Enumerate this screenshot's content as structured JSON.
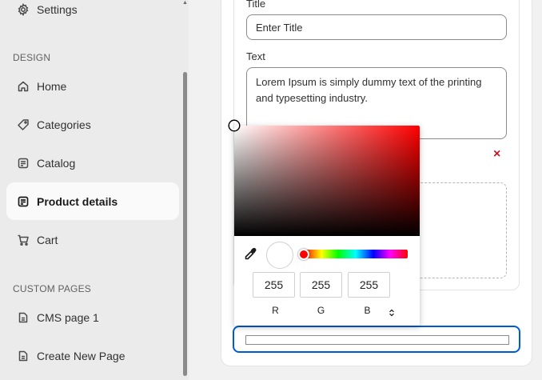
{
  "sidebar": {
    "settings_label": "Settings",
    "design_title": "DESIGN",
    "items": [
      {
        "label": "Home"
      },
      {
        "label": "Categories"
      },
      {
        "label": "Catalog"
      },
      {
        "label": "Product details"
      },
      {
        "label": "Cart"
      }
    ],
    "custom_title": "CUSTOM PAGES",
    "custom_items": [
      {
        "label": "CMS page 1"
      },
      {
        "label": "Create New Page"
      }
    ]
  },
  "form": {
    "title_label": "Title",
    "title_placeholder": "Enter Title",
    "text_label": "Text",
    "text_value": "Lorem Ipsum is simply dummy text of the printing and typesetting industry.",
    "remove_symbol": "×"
  },
  "color_picker": {
    "hue_color": "#ff0000",
    "r": "255",
    "g": "255",
    "b": "255",
    "r_label": "R",
    "g_label": "G",
    "b_label": "B"
  },
  "colors": {
    "accent": "#005bd3",
    "danger": "#c0182b"
  }
}
